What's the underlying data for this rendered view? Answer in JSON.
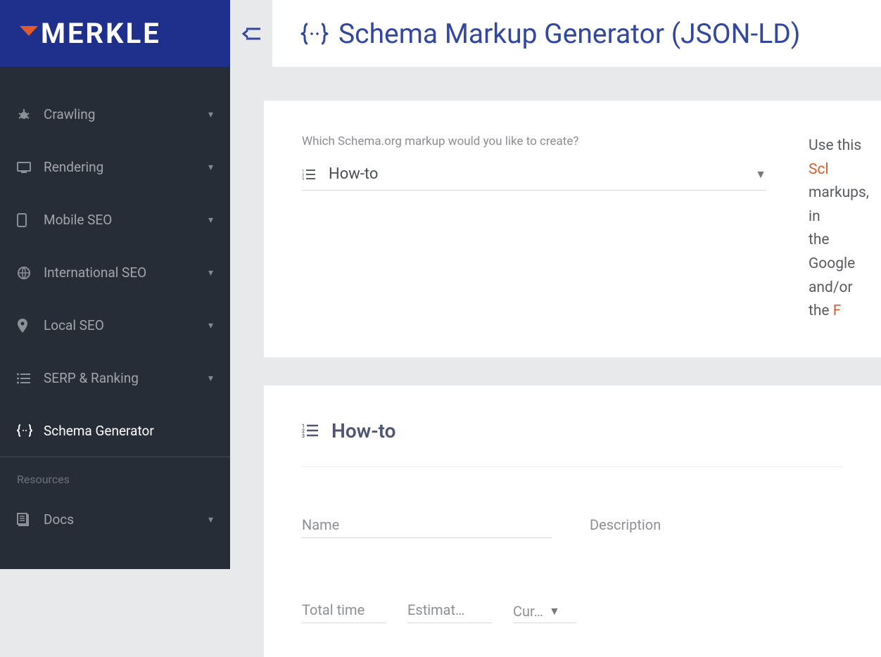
{
  "logo": {
    "text": "MERKLE"
  },
  "sidebar": {
    "items": [
      {
        "label": "Crawling"
      },
      {
        "label": "Rendering"
      },
      {
        "label": "Mobile SEO"
      },
      {
        "label": "International SEO"
      },
      {
        "label": "Local SEO"
      },
      {
        "label": "SERP & Ranking"
      },
      {
        "label": "Schema Generator"
      }
    ],
    "resources_header": "Resources",
    "docs_label": "Docs"
  },
  "header": {
    "title": "Schema Markup Generator (JSON-LD)"
  },
  "card1": {
    "question": "Which Schema.org markup would you like to create?",
    "selected": "How-to",
    "rhs_text1": "Use this ",
    "rhs_link1": "Scl",
    "rhs_text2": "markups, in",
    "rhs_text3": "the Google ",
    "rhs_text4": "and/or the ",
    "rhs_link2": "F"
  },
  "card2": {
    "title": "How-to",
    "fields": {
      "name": "Name",
      "description": "Description",
      "total_time": "Total time",
      "estimated": "Estimat…",
      "currency": "Cur…"
    }
  }
}
